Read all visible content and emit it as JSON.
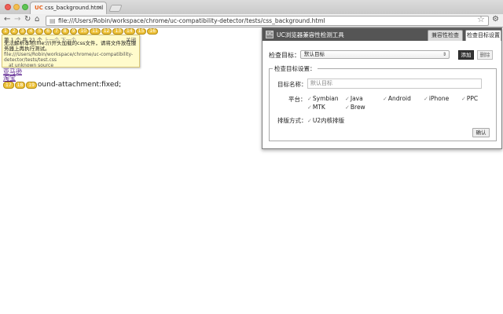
{
  "browser": {
    "tab": {
      "favicon": "UC",
      "title": "css_background.html",
      "close": "×"
    },
    "url": "file:///Users/Robin/workspace/chrome/uc-compatibility-detector/tests/css_background.html",
    "icons": {
      "back": "←",
      "forward": "→",
      "reload": "↻",
      "home": "⌂",
      "page": "▤",
      "star": "☆",
      "wrench": "⚙"
    }
  },
  "page": {
    "badges": [
      "1",
      "2",
      "3",
      "4",
      "5",
      "6",
      "7",
      "8",
      "9",
      "10",
      "11",
      "12",
      "13",
      "14",
      "15",
      "16"
    ],
    "popup": {
      "nav_prefix": "第 1 个 共 21 个",
      "prev": "上一个",
      "next": "下一个",
      "close": "关闭",
      "message": "无法解析本地(file://)开头加载的css文件，请将文件放在服务器上再执行测试。",
      "path": "file:///Users/Robin/workspace/chrome/uc-compatibility-detector/tests/test.css",
      "source": "at unknown source"
    },
    "link1": "亚马逊",
    "link2": "淘宝",
    "inline_badges": [
      "17",
      "18",
      "19"
    ],
    "bg_text": "ound-attachment:fixed;"
  },
  "panel": {
    "logo": "UC",
    "title": "UC浏览器兼容性检测工具",
    "tabs": [
      "兼容性检查",
      "检查目标设置"
    ],
    "target_label": "检查目标：",
    "target_value": "默认目标",
    "add_label": "添加",
    "delete_label": "删除",
    "fieldset_legend": "检查目标设置：",
    "name_label": "目标名称：",
    "name_value": "默认目标",
    "platform_label": "平台：",
    "platforms": [
      "Symbian",
      "Java",
      "Android",
      "iPhone",
      "PPC",
      "MTK",
      "Brew"
    ],
    "layout_label": "排版方式：",
    "layout_option": "U2内核排版",
    "confirm_label": "确认"
  }
}
